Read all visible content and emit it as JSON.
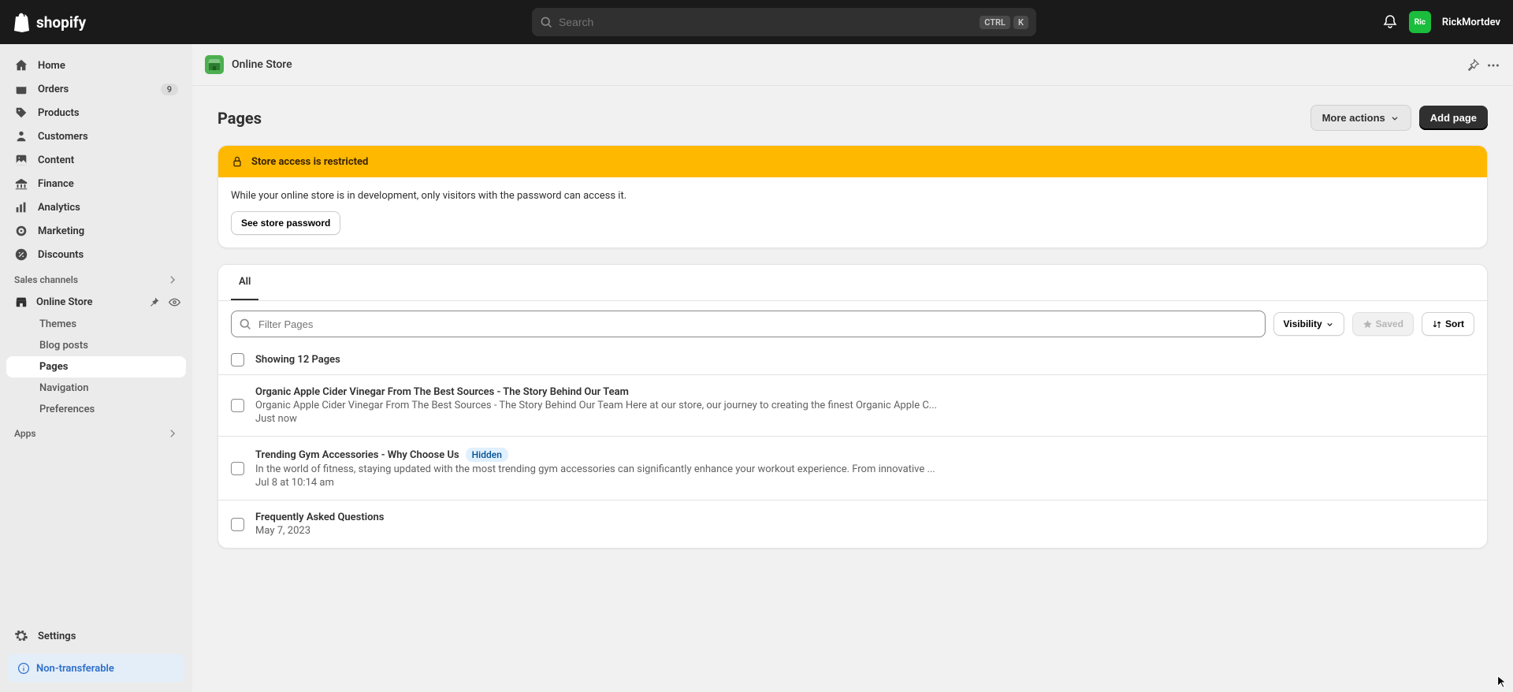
{
  "header": {
    "brand": "shopify",
    "search_placeholder": "Search",
    "kbd1": "CTRL",
    "kbd2": "K",
    "avatar_initials": "Ric",
    "username": "RickMortdev"
  },
  "sidebar": {
    "items": [
      {
        "label": "Home"
      },
      {
        "label": "Orders",
        "badge": "9"
      },
      {
        "label": "Products"
      },
      {
        "label": "Customers"
      },
      {
        "label": "Content"
      },
      {
        "label": "Finance"
      },
      {
        "label": "Analytics"
      },
      {
        "label": "Marketing"
      },
      {
        "label": "Discounts"
      }
    ],
    "sales_channels_label": "Sales channels",
    "online_store_label": "Online Store",
    "subitems": [
      {
        "label": "Themes"
      },
      {
        "label": "Blog posts"
      },
      {
        "label": "Pages"
      },
      {
        "label": "Navigation"
      },
      {
        "label": "Preferences"
      }
    ],
    "apps_label": "Apps",
    "settings_label": "Settings",
    "non_transferable_label": "Non-transferable"
  },
  "main": {
    "breadcrumb": "Online Store",
    "page_title": "Pages",
    "more_actions_label": "More actions",
    "add_page_label": "Add page",
    "banner": {
      "title": "Store access is restricted",
      "body": "While your online store is in development, only visitors with the password can access it.",
      "button": "See store password"
    },
    "tabs": {
      "all": "All"
    },
    "filter_placeholder": "Filter Pages",
    "visibility_label": "Visibility",
    "saved_label": "Saved",
    "sort_label": "Sort",
    "summary": "Showing 12 Pages",
    "rows": [
      {
        "title": "Organic Apple Cider Vinegar From The Best Sources - The Story Behind Our Team",
        "excerpt": "Organic Apple Cider Vinegar From The Best Sources - The Story Behind Our Team Here at our store, our journey to creating the finest Organic Apple C...",
        "date": "Just now",
        "hidden": false
      },
      {
        "title": "Trending Gym Accessories - Why Choose Us",
        "excerpt": "In the world of fitness, staying updated with the most trending gym accessories can significantly enhance your workout experience. From innovative ...",
        "date": "Jul 8 at 10:14 am",
        "hidden": true,
        "hidden_label": "Hidden"
      },
      {
        "title": "Frequently Asked Questions",
        "excerpt": "",
        "date": "May 7, 2023",
        "hidden": false
      }
    ]
  }
}
